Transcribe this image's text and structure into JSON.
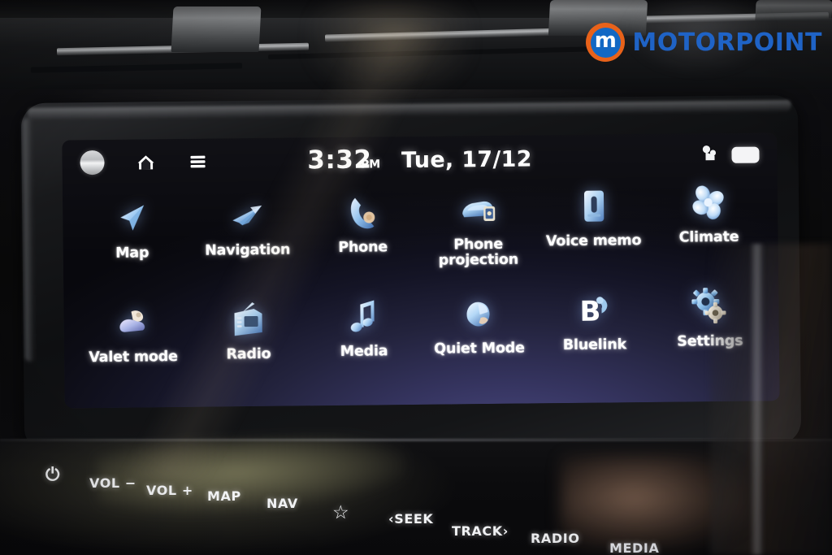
{
  "watermark": {
    "badge_letter": "m",
    "brand": "MOTORPOINT",
    "badge_color": "#e8621a",
    "inner_color": "#1268c4",
    "text_color": "#1f63c6"
  },
  "status_bar": {
    "avatar_icon": "profile-avatar-icon",
    "home_icon": "home-icon",
    "menu_icon": "hamburger-menu-icon",
    "time": "3:32",
    "meridiem": "PM",
    "date": "Tue, 17/12",
    "dashcam_icon": "dashcam-icon",
    "battery_icon": "battery-icon"
  },
  "home_screen": {
    "apps": [
      {
        "label": "Map",
        "icon": "map-arrow-icon",
        "name": "app-map"
      },
      {
        "label": "Navigation",
        "icon": "navigation-arrow-icon",
        "name": "app-navigation"
      },
      {
        "label": "Phone",
        "icon": "phone-handset-icon",
        "name": "app-phone"
      },
      {
        "label": "Phone projection",
        "icon": "car-phone-icon",
        "name": "app-phone-projection"
      },
      {
        "label": "Voice memo",
        "icon": "microphone-icon",
        "name": "app-voice-memo"
      },
      {
        "label": "Climate",
        "icon": "fan-icon",
        "name": "app-climate"
      },
      {
        "label": "Valet mode",
        "icon": "valet-key-icon",
        "name": "app-valet-mode"
      },
      {
        "label": "Radio",
        "icon": "radio-icon",
        "name": "app-radio"
      },
      {
        "label": "Media",
        "icon": "music-note-icon",
        "name": "app-media"
      },
      {
        "label": "Quiet Mode",
        "icon": "quiet-mode-icon",
        "name": "app-quiet-mode"
      },
      {
        "label": "Bluelink",
        "icon": "bluelink-b-icon",
        "name": "app-bluelink"
      },
      {
        "label": "Settings",
        "icon": "gears-icon",
        "name": "app-settings"
      }
    ]
  },
  "hard_keys": [
    {
      "label": "⏻",
      "name": "power-button",
      "icon": "power-icon"
    },
    {
      "label": "VOL −",
      "name": "volume-down-button"
    },
    {
      "label": "VOL +",
      "name": "volume-up-button"
    },
    {
      "label": "MAP",
      "name": "map-button"
    },
    {
      "label": "NAV",
      "name": "nav-button"
    },
    {
      "label": "☆",
      "name": "favourite-button",
      "icon": "star-icon"
    },
    {
      "label": "‹SEEK",
      "name": "seek-back-button"
    },
    {
      "label": "TRACK›",
      "name": "track-forward-button"
    },
    {
      "label": "RADIO",
      "name": "radio-button"
    },
    {
      "label": "MEDIA",
      "name": "media-button"
    }
  ],
  "colors": {
    "screen_accent": "#4c4b84",
    "icon_blue": "#8fc4ef",
    "label_white": "#ffffff"
  }
}
